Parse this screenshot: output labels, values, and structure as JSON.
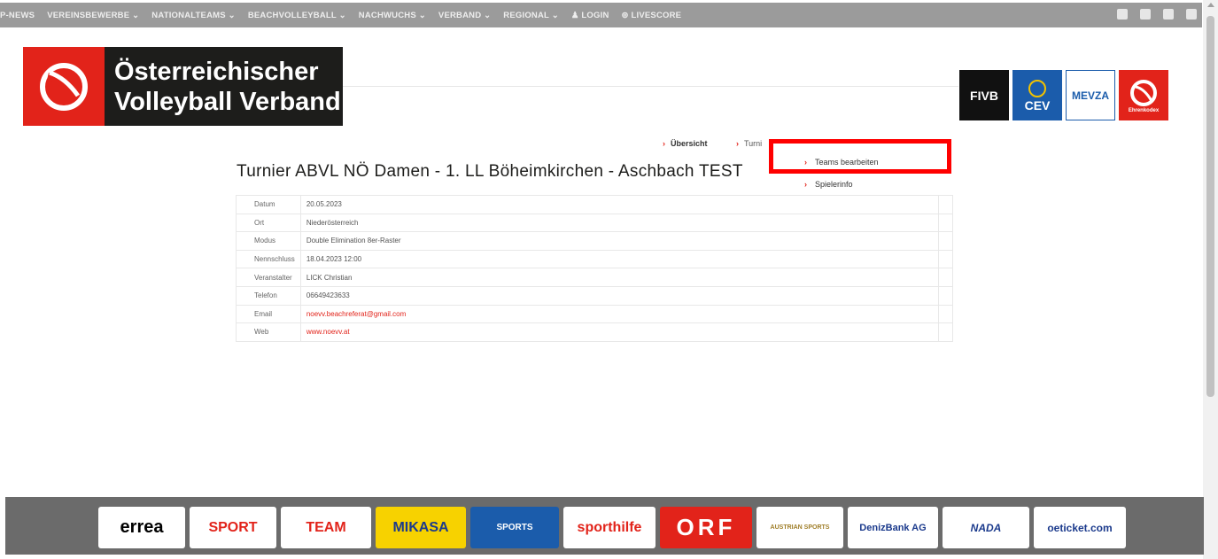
{
  "topnav": {
    "items": [
      "P-NEWS",
      "VEREINSBEWERBE ⌄",
      "NATIONALTEAMS ⌄",
      "BEACHVOLLEYBALL ⌄",
      "NACHWUCHS ⌄",
      "VERBAND ⌄",
      "REGIONAL ⌄",
      "♟ LOGIN",
      "⊚ LIVESCORE"
    ],
    "social_icons": [
      "facebook-icon",
      "twitter-icon",
      "instagram-icon",
      "youtube-icon"
    ]
  },
  "logo": {
    "line1": "Österreichischer",
    "line2": "Volleyball Verband"
  },
  "partners": [
    {
      "name": "FIVB",
      "color": "#111111"
    },
    {
      "name": "CEV",
      "color": "#1b5cab"
    },
    {
      "name": "MEVZA",
      "color": "#ffffff"
    },
    {
      "name": "Ehrenkodex",
      "color": "#e2231a"
    }
  ],
  "subnav": {
    "overview": "Übersicht",
    "tournament": "Turni"
  },
  "dropdown": {
    "teams": "Teams bearbeiten",
    "players": "Spielerinfo"
  },
  "title": "Turnier ABVL NÖ Damen - 1. LL Böheimkirchen - Aschbach TEST",
  "info": [
    {
      "key": "Datum",
      "value": "20.05.2023",
      "link": false
    },
    {
      "key": "Ort",
      "value": "Niederösterreich",
      "link": false
    },
    {
      "key": "Modus",
      "value": "Double Elimination 8er-Raster",
      "link": false
    },
    {
      "key": "Nennschluss",
      "value": "18.04.2023 12:00",
      "link": false
    },
    {
      "key": "Veranstalter",
      "value": "LICK Christian",
      "link": false
    },
    {
      "key": "Telefon",
      "value": "06649423633",
      "link": false
    },
    {
      "key": "Email",
      "value": "noevv.beachreferat@gmail.com",
      "link": true
    },
    {
      "key": "Web",
      "value": "www.noevv.at",
      "link": true
    }
  ],
  "sponsors": [
    {
      "name": "errea",
      "color": "#000000"
    },
    {
      "name": "SPORT",
      "color": "#e2231a"
    },
    {
      "name": "TEAM",
      "color": "#e2231a"
    },
    {
      "name": "MIKASA",
      "color": "#1b3a8c"
    },
    {
      "name": "SPORTS",
      "color": "#1b5cab"
    },
    {
      "name": "sporthilfe",
      "color": "#e2231a"
    },
    {
      "name": "ORF",
      "color": "#e2231a"
    },
    {
      "name": "AUSTRIAN SPORTS",
      "color": "#a07f2a"
    },
    {
      "name": "DenizBank AG",
      "color": "#1b3a8c"
    },
    {
      "name": "NADA",
      "color": "#1b3a8c"
    },
    {
      "name": "oeticket.com",
      "color": "#1b3a8c"
    }
  ]
}
